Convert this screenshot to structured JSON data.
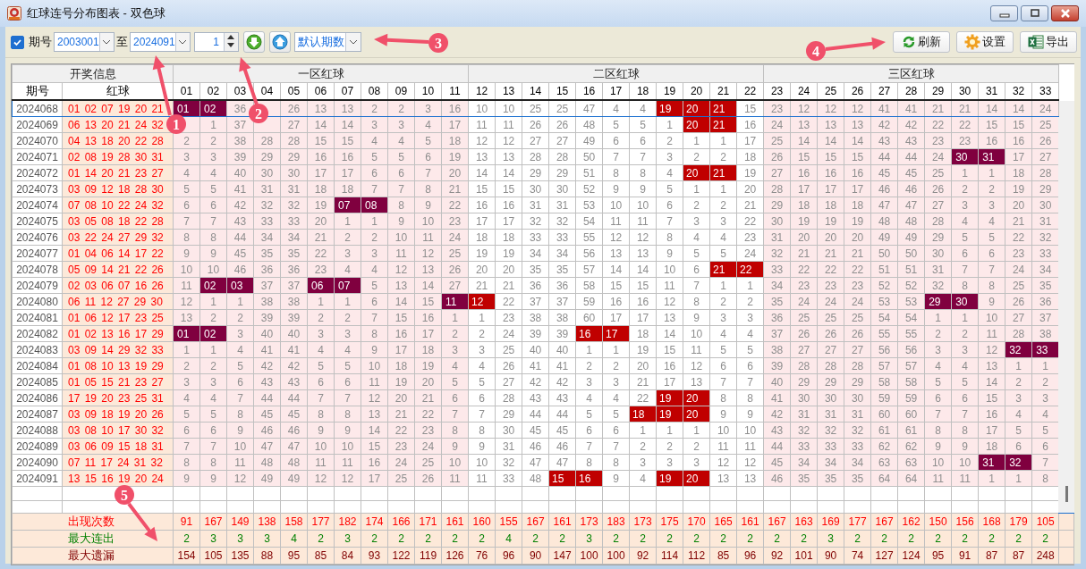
{
  "window": {
    "title": "红球连号分布图表 - 双色球"
  },
  "toolbar": {
    "checkbox": {
      "label": "期号",
      "checked": true
    },
    "from": "2003001",
    "to_label": "至",
    "to": "2024091",
    "step": "1",
    "preset": "默认期数",
    "buttons": [
      {
        "kind": "refresh",
        "label": "刷新"
      },
      {
        "kind": "settings",
        "label": "设置"
      },
      {
        "kind": "export",
        "label": "导出"
      }
    ]
  },
  "table": {
    "info_header": "开奖信息",
    "issue_header": "期号",
    "balls_header": "红球",
    "zones": [
      {
        "label": "一区红球",
        "shaded": true,
        "columns": [
          "01",
          "02",
          "03",
          "04",
          "05",
          "06",
          "07",
          "08",
          "09",
          "10",
          "11"
        ]
      },
      {
        "label": "二区红球",
        "shaded": false,
        "columns": [
          "12",
          "13",
          "14",
          "15",
          "16",
          "17",
          "18",
          "19",
          "20",
          "21",
          "22"
        ]
      },
      {
        "label": "三区红球",
        "shaded": true,
        "columns": [
          "23",
          "24",
          "25",
          "26",
          "27",
          "28",
          "29",
          "30",
          "31",
          "32",
          "33"
        ]
      }
    ],
    "rows": [
      {
        "issue": "2024068",
        "balls": "01 02 07 19 20 21",
        "selected": true,
        "cells": [
          "01",
          "02",
          "36",
          null,
          "26",
          "13",
          "13",
          "2",
          "2",
          "3",
          "16",
          "10",
          "10",
          "25",
          "25",
          "47",
          "4",
          "4",
          "19",
          "20",
          "21",
          "15",
          "23",
          "12",
          "12",
          "12",
          "41",
          "41",
          "21",
          "21",
          "14",
          "14",
          "24"
        ],
        "hits": [
          true,
          true,
          false,
          false,
          false,
          false,
          false,
          false,
          false,
          false,
          false,
          false,
          false,
          false,
          false,
          false,
          false,
          false,
          true,
          true,
          true,
          false,
          false,
          false,
          false,
          false,
          false,
          false,
          false,
          false,
          false,
          false,
          false
        ]
      },
      {
        "issue": "2024069",
        "balls": "06 13 20 21 24 32",
        "selected": false,
        "cells": [
          null,
          "1",
          "37",
          null,
          "27",
          "14",
          "14",
          "3",
          "3",
          "4",
          "17",
          "11",
          "11",
          "26",
          "26",
          "48",
          "5",
          "5",
          "1",
          "20",
          "21",
          "16",
          "24",
          "13",
          "13",
          "13",
          "42",
          "42",
          "22",
          "22",
          "15",
          "15",
          "25"
        ],
        "hits": [
          false,
          false,
          false,
          false,
          false,
          false,
          false,
          false,
          false,
          false,
          false,
          false,
          false,
          false,
          false,
          false,
          false,
          false,
          false,
          true,
          true,
          false,
          false,
          false,
          false,
          false,
          false,
          false,
          false,
          false,
          false,
          false,
          false
        ]
      },
      {
        "issue": "2024070",
        "balls": "04 13 18 20 22 28",
        "selected": false,
        "cells": [
          "2",
          "2",
          "38",
          "28",
          "28",
          "15",
          "15",
          "4",
          "4",
          "5",
          "18",
          "12",
          "12",
          "27",
          "27",
          "49",
          "6",
          "6",
          "2",
          "1",
          "1",
          "17",
          "25",
          "14",
          "14",
          "14",
          "43",
          "43",
          "23",
          "23",
          "16",
          "16",
          "26"
        ],
        "hits": [
          false,
          false,
          false,
          false,
          false,
          false,
          false,
          false,
          false,
          false,
          false,
          false,
          false,
          false,
          false,
          false,
          false,
          false,
          false,
          false,
          false,
          false,
          false,
          false,
          false,
          false,
          false,
          false,
          false,
          false,
          false,
          false,
          false
        ]
      },
      {
        "issue": "2024071",
        "balls": "02 08 19 28 30 31",
        "selected": false,
        "cells": [
          "3",
          "3",
          "39",
          "29",
          "29",
          "16",
          "16",
          "5",
          "5",
          "6",
          "19",
          "13",
          "13",
          "28",
          "28",
          "50",
          "7",
          "7",
          "3",
          "2",
          "2",
          "18",
          "26",
          "15",
          "15",
          "15",
          "44",
          "44",
          "24",
          "30",
          "31",
          "17",
          "27"
        ],
        "hits": [
          false,
          false,
          false,
          false,
          false,
          false,
          false,
          false,
          false,
          false,
          false,
          false,
          false,
          false,
          false,
          false,
          false,
          false,
          false,
          false,
          false,
          false,
          false,
          false,
          false,
          false,
          false,
          false,
          false,
          true,
          true,
          false,
          false
        ]
      },
      {
        "issue": "2024072",
        "balls": "01 14 20 21 23 27",
        "selected": false,
        "cells": [
          "4",
          "4",
          "40",
          "30",
          "30",
          "17",
          "17",
          "6",
          "6",
          "7",
          "20",
          "14",
          "14",
          "29",
          "29",
          "51",
          "8",
          "8",
          "4",
          "20",
          "21",
          "19",
          "27",
          "16",
          "16",
          "16",
          "45",
          "45",
          "25",
          "1",
          "1",
          "18",
          "28"
        ],
        "hits": [
          false,
          false,
          false,
          false,
          false,
          false,
          false,
          false,
          false,
          false,
          false,
          false,
          false,
          false,
          false,
          false,
          false,
          false,
          false,
          true,
          true,
          false,
          false,
          false,
          false,
          false,
          false,
          false,
          false,
          false,
          false,
          false,
          false
        ]
      },
      {
        "issue": "2024073",
        "balls": "03 09 12 18 28 30",
        "selected": false,
        "cells": [
          "5",
          "5",
          "41",
          "31",
          "31",
          "18",
          "18",
          "7",
          "7",
          "8",
          "21",
          "15",
          "15",
          "30",
          "30",
          "52",
          "9",
          "9",
          "5",
          "1",
          "1",
          "20",
          "28",
          "17",
          "17",
          "17",
          "46",
          "46",
          "26",
          "2",
          "2",
          "19",
          "29"
        ],
        "hits": [
          false,
          false,
          false,
          false,
          false,
          false,
          false,
          false,
          false,
          false,
          false,
          false,
          false,
          false,
          false,
          false,
          false,
          false,
          false,
          false,
          false,
          false,
          false,
          false,
          false,
          false,
          false,
          false,
          false,
          false,
          false,
          false,
          false
        ]
      },
      {
        "issue": "2024074",
        "balls": "07 08 10 22 24 32",
        "selected": false,
        "cells": [
          "6",
          "6",
          "42",
          "32",
          "32",
          "19",
          "07",
          "08",
          "8",
          "9",
          "22",
          "16",
          "16",
          "31",
          "31",
          "53",
          "10",
          "10",
          "6",
          "2",
          "2",
          "21",
          "29",
          "18",
          "18",
          "18",
          "47",
          "47",
          "27",
          "3",
          "3",
          "20",
          "30"
        ],
        "hits": [
          false,
          false,
          false,
          false,
          false,
          false,
          true,
          true,
          false,
          false,
          false,
          false,
          false,
          false,
          false,
          false,
          false,
          false,
          false,
          false,
          false,
          false,
          false,
          false,
          false,
          false,
          false,
          false,
          false,
          false,
          false,
          false,
          false
        ]
      },
      {
        "issue": "2024075",
        "balls": "03 05 08 18 22 28",
        "selected": false,
        "cells": [
          "7",
          "7",
          "43",
          "33",
          "33",
          "20",
          "1",
          "1",
          "9",
          "10",
          "23",
          "17",
          "17",
          "32",
          "32",
          "54",
          "11",
          "11",
          "7",
          "3",
          "3",
          "22",
          "30",
          "19",
          "19",
          "19",
          "48",
          "48",
          "28",
          "4",
          "4",
          "21",
          "31"
        ],
        "hits": [
          false,
          false,
          false,
          false,
          false,
          false,
          false,
          false,
          false,
          false,
          false,
          false,
          false,
          false,
          false,
          false,
          false,
          false,
          false,
          false,
          false,
          false,
          false,
          false,
          false,
          false,
          false,
          false,
          false,
          false,
          false,
          false,
          false
        ]
      },
      {
        "issue": "2024076",
        "balls": "03 22 24 27 29 32",
        "selected": false,
        "cells": [
          "8",
          "8",
          "44",
          "34",
          "34",
          "21",
          "2",
          "2",
          "10",
          "11",
          "24",
          "18",
          "18",
          "33",
          "33",
          "55",
          "12",
          "12",
          "8",
          "4",
          "4",
          "23",
          "31",
          "20",
          "20",
          "20",
          "49",
          "49",
          "29",
          "5",
          "5",
          "22",
          "32"
        ],
        "hits": [
          false,
          false,
          false,
          false,
          false,
          false,
          false,
          false,
          false,
          false,
          false,
          false,
          false,
          false,
          false,
          false,
          false,
          false,
          false,
          false,
          false,
          false,
          false,
          false,
          false,
          false,
          false,
          false,
          false,
          false,
          false,
          false,
          false
        ]
      },
      {
        "issue": "2024077",
        "balls": "01 04 06 14 17 22",
        "selected": false,
        "cells": [
          "9",
          "9",
          "45",
          "35",
          "35",
          "22",
          "3",
          "3",
          "11",
          "12",
          "25",
          "19",
          "19",
          "34",
          "34",
          "56",
          "13",
          "13",
          "9",
          "5",
          "5",
          "24",
          "32",
          "21",
          "21",
          "21",
          "50",
          "50",
          "30",
          "6",
          "6",
          "23",
          "33"
        ],
        "hits": [
          false,
          false,
          false,
          false,
          false,
          false,
          false,
          false,
          false,
          false,
          false,
          false,
          false,
          false,
          false,
          false,
          false,
          false,
          false,
          false,
          false,
          false,
          false,
          false,
          false,
          false,
          false,
          false,
          false,
          false,
          false,
          false,
          false
        ]
      },
      {
        "issue": "2024078",
        "balls": "05 09 14 21 22 26",
        "selected": false,
        "cells": [
          "10",
          "10",
          "46",
          "36",
          "36",
          "23",
          "4",
          "4",
          "12",
          "13",
          "26",
          "20",
          "20",
          "35",
          "35",
          "57",
          "14",
          "14",
          "10",
          "6",
          "21",
          "22",
          "33",
          "22",
          "22",
          "22",
          "51",
          "51",
          "31",
          "7",
          "7",
          "24",
          "34"
        ],
        "hits": [
          false,
          false,
          false,
          false,
          false,
          false,
          false,
          false,
          false,
          false,
          false,
          false,
          false,
          false,
          false,
          false,
          false,
          false,
          false,
          false,
          true,
          true,
          false,
          false,
          false,
          false,
          false,
          false,
          false,
          false,
          false,
          false,
          false
        ]
      },
      {
        "issue": "2024079",
        "balls": "02 03 06 07 16 26",
        "selected": false,
        "cells": [
          "11",
          "02",
          "03",
          "37",
          "37",
          "06",
          "07",
          "5",
          "13",
          "14",
          "27",
          "21",
          "21",
          "36",
          "36",
          "58",
          "15",
          "15",
          "11",
          "7",
          "1",
          "1",
          "34",
          "23",
          "23",
          "23",
          "52",
          "52",
          "32",
          "8",
          "8",
          "25",
          "35"
        ],
        "hits": [
          false,
          true,
          true,
          false,
          false,
          true,
          true,
          false,
          false,
          false,
          false,
          false,
          false,
          false,
          false,
          false,
          false,
          false,
          false,
          false,
          false,
          false,
          false,
          false,
          false,
          false,
          false,
          false,
          false,
          false,
          false,
          false,
          false
        ]
      },
      {
        "issue": "2024080",
        "balls": "06 11 12 27 29 30",
        "selected": false,
        "cells": [
          "12",
          "1",
          "1",
          "38",
          "38",
          "1",
          "1",
          "6",
          "14",
          "15",
          "11",
          "12",
          "22",
          "37",
          "37",
          "59",
          "16",
          "16",
          "12",
          "8",
          "2",
          "2",
          "35",
          "24",
          "24",
          "24",
          "53",
          "53",
          "29",
          "30",
          "9",
          "26",
          "36"
        ],
        "hits": [
          false,
          false,
          false,
          false,
          false,
          false,
          false,
          false,
          false,
          false,
          true,
          true,
          false,
          false,
          false,
          false,
          false,
          false,
          false,
          false,
          false,
          false,
          false,
          false,
          false,
          false,
          false,
          false,
          true,
          true,
          false,
          false,
          false
        ]
      },
      {
        "issue": "2024081",
        "balls": "01 06 12 17 23 25",
        "selected": false,
        "cells": [
          "13",
          "2",
          "2",
          "39",
          "39",
          "2",
          "2",
          "7",
          "15",
          "16",
          "1",
          "1",
          "23",
          "38",
          "38",
          "60",
          "17",
          "17",
          "13",
          "9",
          "3",
          "3",
          "36",
          "25",
          "25",
          "25",
          "54",
          "54",
          "1",
          "1",
          "10",
          "27",
          "37"
        ],
        "hits": [
          false,
          false,
          false,
          false,
          false,
          false,
          false,
          false,
          false,
          false,
          false,
          false,
          false,
          false,
          false,
          false,
          false,
          false,
          false,
          false,
          false,
          false,
          false,
          false,
          false,
          false,
          false,
          false,
          false,
          false,
          false,
          false,
          false
        ]
      },
      {
        "issue": "2024082",
        "balls": "01 02 13 16 17 29",
        "selected": false,
        "cells": [
          "01",
          "02",
          "3",
          "40",
          "40",
          "3",
          "3",
          "8",
          "16",
          "17",
          "2",
          "2",
          "24",
          "39",
          "39",
          "16",
          "17",
          "18",
          "14",
          "10",
          "4",
          "4",
          "37",
          "26",
          "26",
          "26",
          "55",
          "55",
          "2",
          "2",
          "11",
          "28",
          "38"
        ],
        "hits": [
          true,
          true,
          false,
          false,
          false,
          false,
          false,
          false,
          false,
          false,
          false,
          false,
          false,
          false,
          false,
          true,
          true,
          false,
          false,
          false,
          false,
          false,
          false,
          false,
          false,
          false,
          false,
          false,
          false,
          false,
          false,
          false,
          false
        ]
      },
      {
        "issue": "2024083",
        "balls": "03 09 14 29 32 33",
        "selected": false,
        "cells": [
          "1",
          "1",
          "4",
          "41",
          "41",
          "4",
          "4",
          "9",
          "17",
          "18",
          "3",
          "3",
          "25",
          "40",
          "40",
          "1",
          "1",
          "19",
          "15",
          "11",
          "5",
          "5",
          "38",
          "27",
          "27",
          "27",
          "56",
          "56",
          "3",
          "3",
          "12",
          "32",
          "33"
        ],
        "hits": [
          false,
          false,
          false,
          false,
          false,
          false,
          false,
          false,
          false,
          false,
          false,
          false,
          false,
          false,
          false,
          false,
          false,
          false,
          false,
          false,
          false,
          false,
          false,
          false,
          false,
          false,
          false,
          false,
          false,
          false,
          false,
          true,
          true
        ]
      },
      {
        "issue": "2024084",
        "balls": "01 08 10 13 19 29",
        "selected": false,
        "cells": [
          "2",
          "2",
          "5",
          "42",
          "42",
          "5",
          "5",
          "10",
          "18",
          "19",
          "4",
          "4",
          "26",
          "41",
          "41",
          "2",
          "2",
          "20",
          "16",
          "12",
          "6",
          "6",
          "39",
          "28",
          "28",
          "28",
          "57",
          "57",
          "4",
          "4",
          "13",
          "1",
          "1"
        ],
        "hits": [
          false,
          false,
          false,
          false,
          false,
          false,
          false,
          false,
          false,
          false,
          false,
          false,
          false,
          false,
          false,
          false,
          false,
          false,
          false,
          false,
          false,
          false,
          false,
          false,
          false,
          false,
          false,
          false,
          false,
          false,
          false,
          false,
          false
        ]
      },
      {
        "issue": "2024085",
        "balls": "01 05 15 21 23 27",
        "selected": false,
        "cells": [
          "3",
          "3",
          "6",
          "43",
          "43",
          "6",
          "6",
          "11",
          "19",
          "20",
          "5",
          "5",
          "27",
          "42",
          "42",
          "3",
          "3",
          "21",
          "17",
          "13",
          "7",
          "7",
          "40",
          "29",
          "29",
          "29",
          "58",
          "58",
          "5",
          "5",
          "14",
          "2",
          "2"
        ],
        "hits": [
          false,
          false,
          false,
          false,
          false,
          false,
          false,
          false,
          false,
          false,
          false,
          false,
          false,
          false,
          false,
          false,
          false,
          false,
          false,
          false,
          false,
          false,
          false,
          false,
          false,
          false,
          false,
          false,
          false,
          false,
          false,
          false,
          false
        ]
      },
      {
        "issue": "2024086",
        "balls": "17 19 20 23 25 31",
        "selected": false,
        "cells": [
          "4",
          "4",
          "7",
          "44",
          "44",
          "7",
          "7",
          "12",
          "20",
          "21",
          "6",
          "6",
          "28",
          "43",
          "43",
          "4",
          "4",
          "22",
          "19",
          "20",
          "8",
          "8",
          "41",
          "30",
          "30",
          "30",
          "59",
          "59",
          "6",
          "6",
          "15",
          "3",
          "3"
        ],
        "hits": [
          false,
          false,
          false,
          false,
          false,
          false,
          false,
          false,
          false,
          false,
          false,
          false,
          false,
          false,
          false,
          false,
          false,
          false,
          true,
          true,
          false,
          false,
          false,
          false,
          false,
          false,
          false,
          false,
          false,
          false,
          false,
          false,
          false
        ]
      },
      {
        "issue": "2024087",
        "balls": "03 09 18 19 20 26",
        "selected": false,
        "cells": [
          "5",
          "5",
          "8",
          "45",
          "45",
          "8",
          "8",
          "13",
          "21",
          "22",
          "7",
          "7",
          "29",
          "44",
          "44",
          "5",
          "5",
          "18",
          "19",
          "20",
          "9",
          "9",
          "42",
          "31",
          "31",
          "31",
          "60",
          "60",
          "7",
          "7",
          "16",
          "4",
          "4"
        ],
        "hits": [
          false,
          false,
          false,
          false,
          false,
          false,
          false,
          false,
          false,
          false,
          false,
          false,
          false,
          false,
          false,
          false,
          false,
          true,
          true,
          true,
          false,
          false,
          false,
          false,
          false,
          false,
          false,
          false,
          false,
          false,
          false,
          false,
          false
        ]
      },
      {
        "issue": "2024088",
        "balls": "03 08 10 17 30 32",
        "selected": false,
        "cells": [
          "6",
          "6",
          "9",
          "46",
          "46",
          "9",
          "9",
          "14",
          "22",
          "23",
          "8",
          "8",
          "30",
          "45",
          "45",
          "6",
          "6",
          "1",
          "1",
          "1",
          "10",
          "10",
          "43",
          "32",
          "32",
          "32",
          "61",
          "61",
          "8",
          "8",
          "17",
          "5",
          "5"
        ],
        "hits": [
          false,
          false,
          false,
          false,
          false,
          false,
          false,
          false,
          false,
          false,
          false,
          false,
          false,
          false,
          false,
          false,
          false,
          false,
          false,
          false,
          false,
          false,
          false,
          false,
          false,
          false,
          false,
          false,
          false,
          false,
          false,
          false,
          false
        ]
      },
      {
        "issue": "2024089",
        "balls": "03 06 09 15 18 31",
        "selected": false,
        "cells": [
          "7",
          "7",
          "10",
          "47",
          "47",
          "10",
          "10",
          "15",
          "23",
          "24",
          "9",
          "9",
          "31",
          "46",
          "46",
          "7",
          "7",
          "2",
          "2",
          "2",
          "11",
          "11",
          "44",
          "33",
          "33",
          "33",
          "62",
          "62",
          "9",
          "9",
          "18",
          "6",
          "6"
        ],
        "hits": [
          false,
          false,
          false,
          false,
          false,
          false,
          false,
          false,
          false,
          false,
          false,
          false,
          false,
          false,
          false,
          false,
          false,
          false,
          false,
          false,
          false,
          false,
          false,
          false,
          false,
          false,
          false,
          false,
          false,
          false,
          false,
          false,
          false
        ]
      },
      {
        "issue": "2024090",
        "balls": "07 11 17 24 31 32",
        "selected": false,
        "cells": [
          "8",
          "8",
          "11",
          "48",
          "48",
          "11",
          "11",
          "16",
          "24",
          "25",
          "10",
          "10",
          "32",
          "47",
          "47",
          "8",
          "8",
          "3",
          "3",
          "3",
          "12",
          "12",
          "45",
          "34",
          "34",
          "34",
          "63",
          "63",
          "10",
          "10",
          "31",
          "32",
          "7"
        ],
        "hits": [
          false,
          false,
          false,
          false,
          false,
          false,
          false,
          false,
          false,
          false,
          false,
          false,
          false,
          false,
          false,
          false,
          false,
          false,
          false,
          false,
          false,
          false,
          false,
          false,
          false,
          false,
          false,
          false,
          false,
          false,
          true,
          true,
          false
        ]
      },
      {
        "issue": "2024091",
        "balls": "13 15 16 19 20 24",
        "selected": false,
        "cells": [
          "9",
          "9",
          "12",
          "49",
          "49",
          "12",
          "12",
          "17",
          "25",
          "26",
          "11",
          "11",
          "33",
          "48",
          "15",
          "16",
          "9",
          "4",
          "19",
          "20",
          "13",
          "13",
          "46",
          "35",
          "35",
          "35",
          "64",
          "64",
          "11",
          "11",
          "1",
          "1",
          "8"
        ],
        "hits": [
          false,
          false,
          false,
          false,
          false,
          false,
          false,
          false,
          false,
          false,
          false,
          false,
          false,
          false,
          true,
          true,
          false,
          false,
          true,
          true,
          false,
          false,
          false,
          false,
          false,
          false,
          false,
          false,
          false,
          false,
          false,
          false,
          false
        ]
      }
    ],
    "summary": [
      {
        "kind": "count",
        "label": "出现次数",
        "values": [
          "91",
          "167",
          "149",
          "138",
          "158",
          "177",
          "182",
          "174",
          "166",
          "171",
          "161",
          "160",
          "155",
          "167",
          "161",
          "173",
          "183",
          "173",
          "175",
          "170",
          "165",
          "161",
          "167",
          "163",
          "169",
          "177",
          "167",
          "162",
          "150",
          "156",
          "168",
          "179",
          "105"
        ]
      },
      {
        "kind": "streak",
        "label": "最大连出",
        "values": [
          "2",
          "3",
          "3",
          "3",
          "4",
          "2",
          "3",
          "2",
          "2",
          "2",
          "2",
          "2",
          "4",
          "2",
          "2",
          "3",
          "2",
          "2",
          "2",
          "2",
          "2",
          "2",
          "2",
          "2",
          "3",
          "2",
          "2",
          "2",
          "2",
          "2",
          "2",
          "2",
          "2"
        ]
      },
      {
        "kind": "gap",
        "label": "最大遗漏",
        "values": [
          "154",
          "105",
          "135",
          "88",
          "95",
          "85",
          "84",
          "93",
          "122",
          "119",
          "126",
          "76",
          "96",
          "90",
          "147",
          "100",
          "100",
          "92",
          "114",
          "112",
          "85",
          "96",
          "92",
          "101",
          "90",
          "74",
          "127",
          "124",
          "95",
          "91",
          "87",
          "87",
          "248"
        ]
      }
    ]
  },
  "callouts": [
    "1",
    "2",
    "3",
    "4",
    "5"
  ]
}
